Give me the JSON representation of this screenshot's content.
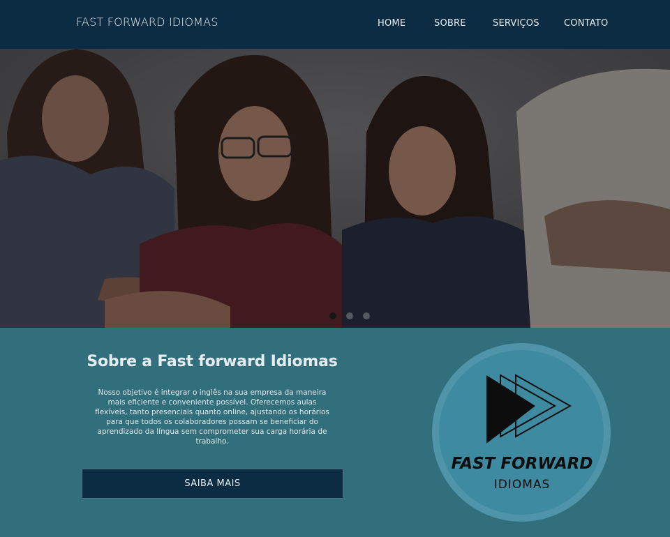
{
  "header": {
    "brand": "FAST FORWARD IDIOMAS",
    "nav": [
      {
        "label": "HOME"
      },
      {
        "label": "SOBRE"
      },
      {
        "label": "SERVIÇOS"
      },
      {
        "label": "CONTATO"
      }
    ]
  },
  "hero": {
    "carousel_slides": 3,
    "active_slide": 1
  },
  "about": {
    "title": "Sobre a Fast forward Idiomas",
    "text": "Nosso objetivo é integrar o inglês na sua empresa da maneira mais eficiente e conveniente possível. Oferecemos aulas flexíveis, tanto presenciais quanto online, ajustando os horários para que todos os colaboradores possam se beneficiar do aprendizado da língua sem comprometer sua carga horária de trabalho.",
    "cta_label": "SAIBA MAIS"
  },
  "logo": {
    "line1": "FAST FORWARD",
    "line2": "IDIOMAS"
  },
  "colors": {
    "header_bg": "#0b2c42",
    "section_bg": "#316f7c",
    "logo_circle": "#3e8aa0"
  }
}
